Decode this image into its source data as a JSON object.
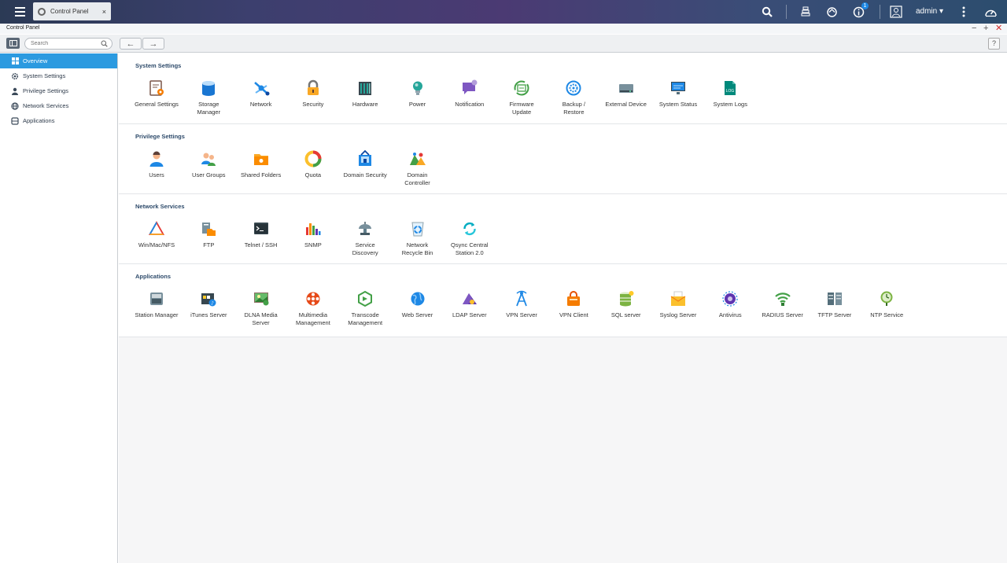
{
  "taskbar": {
    "tab_label": "Control Panel",
    "tab_close": "×",
    "user": "admin ▾",
    "notification_count": "1",
    "icons": [
      "search-icon",
      "stack-icon",
      "sync-icon",
      "info-icon",
      "user-icon",
      "more-icon",
      "dashboard-icon"
    ]
  },
  "window": {
    "title": "Control Panel",
    "minimize": "−",
    "maximize": "+",
    "close": "✕"
  },
  "toolbar": {
    "search_placeholder": "Search",
    "back": "←",
    "forward": "→",
    "help": "?"
  },
  "sidebar": {
    "items": [
      {
        "label": "Overview",
        "icon": "grid-icon"
      },
      {
        "label": "System Settings",
        "icon": "gear-icon"
      },
      {
        "label": "Privilege Settings",
        "icon": "person-icon"
      },
      {
        "label": "Network Services",
        "icon": "globe-icon"
      },
      {
        "label": "Applications",
        "icon": "apps-icon"
      }
    ]
  },
  "sections": [
    {
      "title": "System Settings",
      "items": [
        {
          "label": "General Settings",
          "icon": "general-settings-icon",
          "color": "#8d6e63"
        },
        {
          "label": "Storage Manager",
          "icon": "storage-icon",
          "color": "#1976d2"
        },
        {
          "label": "Network",
          "icon": "network-icon",
          "color": "#1e88e5"
        },
        {
          "label": "Security",
          "icon": "lock-icon",
          "color": "#616161"
        },
        {
          "label": "Hardware",
          "icon": "hardware-icon",
          "color": "#37474f"
        },
        {
          "label": "Power",
          "icon": "bulb-icon",
          "color": "#26a69a"
        },
        {
          "label": "Notification",
          "icon": "notification-icon",
          "color": "#7e57c2"
        },
        {
          "label": "Firmware Update",
          "icon": "firmware-icon",
          "color": "#43a047"
        },
        {
          "label": "Backup / Restore",
          "icon": "backup-icon",
          "color": "#1e88e5"
        },
        {
          "label": "External Device",
          "icon": "external-device-icon",
          "color": "#546e7a"
        },
        {
          "label": "System Status",
          "icon": "monitor-icon",
          "color": "#1e88e5"
        },
        {
          "label": "System Logs",
          "icon": "log-icon",
          "color": "#00897b"
        }
      ]
    },
    {
      "title": "Privilege Settings",
      "items": [
        {
          "label": "Users",
          "icon": "user-icon",
          "color": "#1e88e5"
        },
        {
          "label": "User Groups",
          "icon": "user-groups-icon",
          "color": "#43a047"
        },
        {
          "label": "Shared Folders",
          "icon": "folder-icon",
          "color": "#fb8c00"
        },
        {
          "label": "Quota",
          "icon": "pie-icon",
          "color": "#fbc02d"
        },
        {
          "label": "Domain Security",
          "icon": "domain-security-icon",
          "color": "#1e88e5"
        },
        {
          "label": "Domain Controller",
          "icon": "domain-controller-icon",
          "color": "#f9a825"
        }
      ]
    },
    {
      "title": "Network Services",
      "items": [
        {
          "label": "Win/Mac/NFS",
          "icon": "triangle-icon",
          "color": "#e53935"
        },
        {
          "label": "FTP",
          "icon": "ftp-icon",
          "color": "#78909c"
        },
        {
          "label": "Telnet / SSH",
          "icon": "terminal-icon",
          "color": "#37474f"
        },
        {
          "label": "SNMP",
          "icon": "bars-icon",
          "color": "#5e35b1"
        },
        {
          "label": "Service Discovery",
          "icon": "dish-icon",
          "color": "#78909c"
        },
        {
          "label": "Network Recycle Bin",
          "icon": "recycle-icon",
          "color": "#1e88e5"
        },
        {
          "label": "Qsync Central Station 2.0",
          "icon": "qsync-icon",
          "color": "#00acc1"
        }
      ]
    },
    {
      "title": "Applications",
      "items": [
        {
          "label": "Station Manager",
          "icon": "station-icon",
          "color": "#78909c"
        },
        {
          "label": "iTunes Server",
          "icon": "itunes-icon",
          "color": "#37474f"
        },
        {
          "label": "DLNA Media Server",
          "icon": "dlna-icon",
          "color": "#43a047"
        },
        {
          "label": "Multimedia Management",
          "icon": "film-icon",
          "color": "#e64a19"
        },
        {
          "label": "Transcode Management",
          "icon": "transcode-icon",
          "color": "#43a047"
        },
        {
          "label": "Web Server",
          "icon": "web-icon",
          "color": "#1e88e5"
        },
        {
          "label": "LDAP Server",
          "icon": "ldap-icon",
          "color": "#5e35b1"
        },
        {
          "label": "VPN Server",
          "icon": "vpn-server-icon",
          "color": "#1e88e5"
        },
        {
          "label": "VPN Client",
          "icon": "vpn-client-icon",
          "color": "#f57c00"
        },
        {
          "label": "SQL server",
          "icon": "database-icon",
          "color": "#7cb342"
        },
        {
          "label": "Syslog Server",
          "icon": "envelope-icon",
          "color": "#fbc02d"
        },
        {
          "label": "Antivirus",
          "icon": "antivirus-icon",
          "color": "#5e35b1"
        },
        {
          "label": "RADIUS Server",
          "icon": "wifi-icon",
          "color": "#43a047"
        },
        {
          "label": "TFTP Server",
          "icon": "server-icon",
          "color": "#546e7a"
        },
        {
          "label": "NTP Service",
          "icon": "clock-icon",
          "color": "#7cb342"
        }
      ]
    }
  ]
}
